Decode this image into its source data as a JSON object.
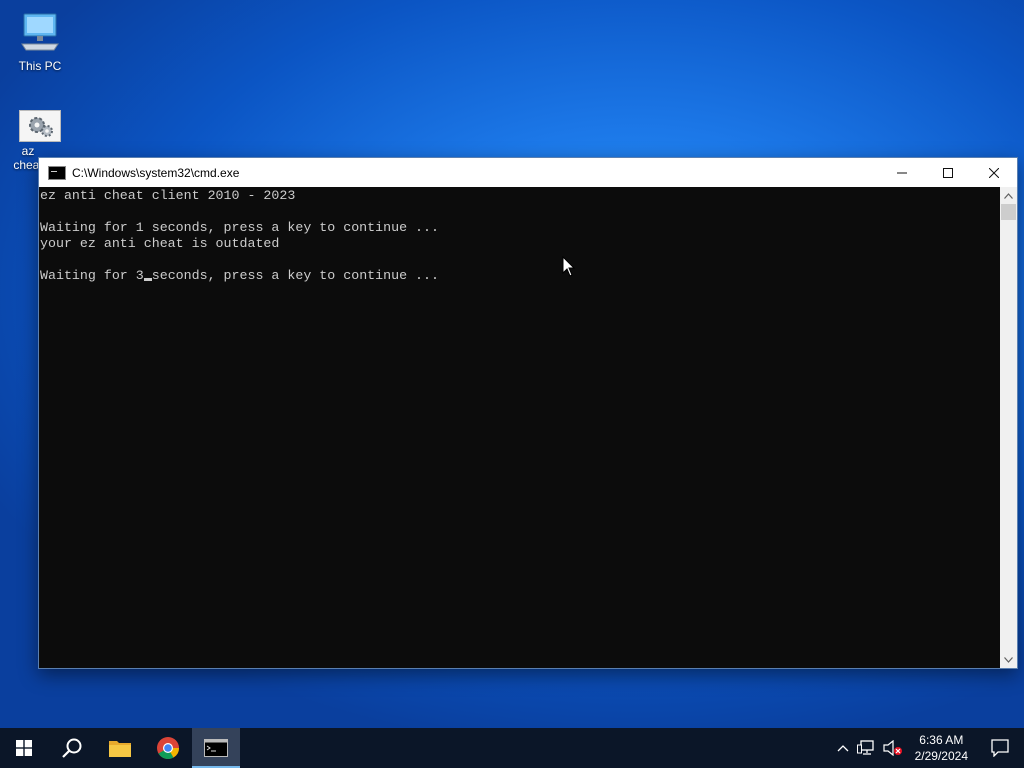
{
  "desktop": {
    "icons": [
      {
        "label": "This PC"
      },
      {
        "label": "az\ncheat"
      }
    ]
  },
  "window": {
    "title": "C:\\Windows\\system32\\cmd.exe",
    "console_lines": [
      "ez anti cheat client 2010 - 2023",
      "",
      "Waiting for 1 seconds, press a key to continue ...",
      "your ez anti cheat is outdated",
      "",
      "Waiting for 3"
    ],
    "last_line_rest": "seconds, press a key to continue ..."
  },
  "taskbar": {
    "clock_time": "6:36 AM",
    "clock_date": "2/29/2024"
  },
  "icons": {
    "start": "windows-start-icon",
    "search": "search-icon",
    "explorer": "file-explorer-icon",
    "chrome": "chrome-icon",
    "cmd": "cmd-icon"
  },
  "colors": {
    "console_bg": "#0c0c0c",
    "console_fg": "#cccccc",
    "taskbar_bg": "#0b1628",
    "accent": "#76b9ed"
  }
}
